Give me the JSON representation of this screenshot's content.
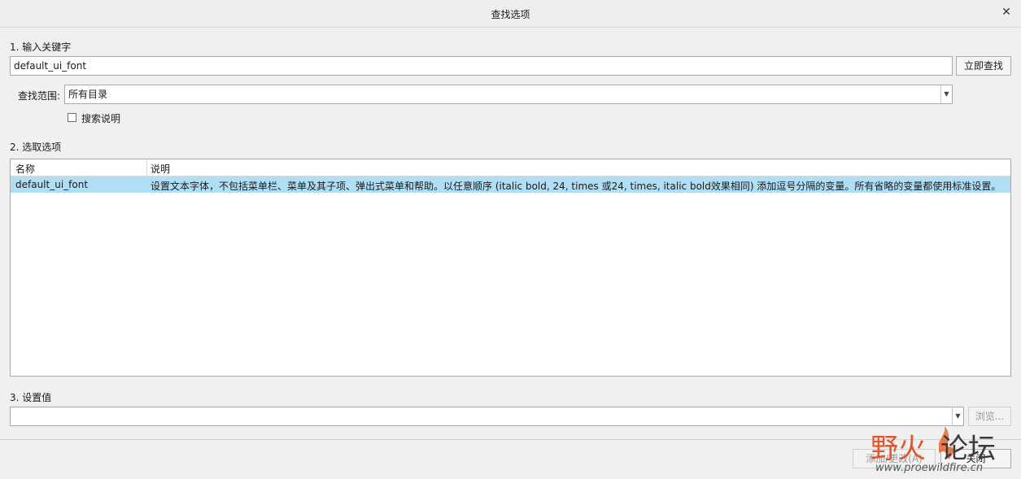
{
  "dialog": {
    "title": "查找选项",
    "close_icon": "close-icon"
  },
  "step1": {
    "label": "1.  输入关键字",
    "keyword_value": "default_ui_font",
    "search_button": "立即查找",
    "scope_label": "查找范围:",
    "scope_value": "所有目录",
    "search_desc_label": "搜索说明"
  },
  "step2": {
    "label": "2.  选取选项",
    "columns": [
      "名称",
      "说明"
    ],
    "rows": [
      {
        "name": "default_ui_font",
        "desc": "设置文本字体，不包括菜单栏、菜单及其子项、弹出式菜单和帮助。以任意顺序 (italic bold, 24, times 或24, times, italic bold效果相同) 添加逗号分隔的变量。所有省略的变量都使用标准设置。"
      }
    ],
    "selected_row_color": "#b0dff5"
  },
  "step3": {
    "label": "3.  设置值",
    "value": "",
    "browse_button": "浏览..."
  },
  "footer": {
    "add_change_button": "添加/更改(A)",
    "close_button": "关闭"
  },
  "watermark": {
    "main": "野火论坛",
    "url": "www.proewildfire.cn"
  }
}
